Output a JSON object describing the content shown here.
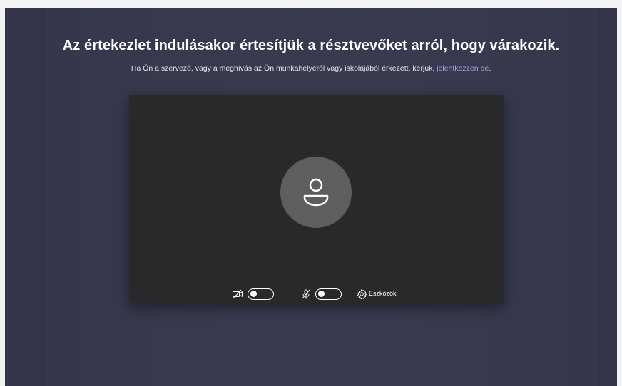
{
  "header": {
    "title": "Az értekezlet indulásakor értesítjük a résztvevőket arról, hogy várakozik.",
    "subtitle_text": "Ha Ön a szervező, vagy a meghívás az Ön munkahelyéről vagy iskolájából érkezett, kérjük,",
    "subtitle_link": "jelentkezzen be",
    "subtitle_end": "."
  },
  "preview": {
    "avatar_icon": "person-icon",
    "camera": {
      "icon": "camera-off-icon",
      "toggle_on": false
    },
    "microphone": {
      "icon": "mic-off-icon",
      "toggle_on": false
    },
    "tools": {
      "icon": "gear-icon",
      "label": "Eszközök"
    }
  },
  "colors": {
    "background": "#33344a",
    "preview_bg": "#292929",
    "avatar_bg": "#5e5e5e",
    "link": "#a6a7dc"
  }
}
